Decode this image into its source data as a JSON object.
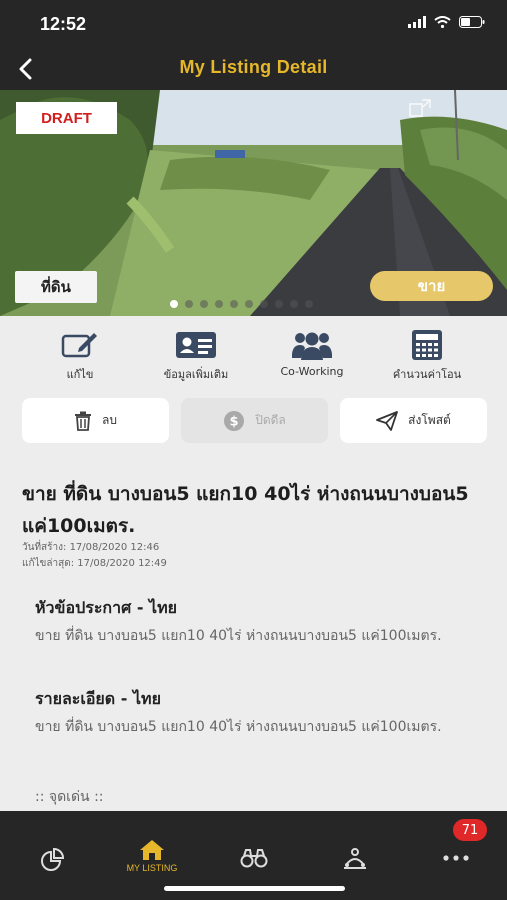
{
  "status_bar": {
    "time": "12:52"
  },
  "nav": {
    "title": "My Listing Detail",
    "back_icon": "chevron-left-icon"
  },
  "hero": {
    "status_badge": "DRAFT",
    "property_type": "ที่ดิน",
    "sale_type": "ขาย",
    "carousel_total": 10,
    "carousel_active": 1
  },
  "actions": [
    {
      "label": "แก้ไข",
      "icon": "edit-icon"
    },
    {
      "label": "ข้อมูลเพิ่มเติม",
      "icon": "id-card-icon"
    },
    {
      "label": "Co-Working",
      "icon": "users-icon"
    },
    {
      "label": "คำนวนค่าโอน",
      "icon": "calculator-icon"
    }
  ],
  "buttons": {
    "delete": "ลบ",
    "close_deal": "ปิดดีล",
    "post": "ส่งโพสต์"
  },
  "listing": {
    "title": "ขาย  ที่ดิน บางบอน5 แยก10 40ไร่  ห่างถนนบางบอน5 แค่100เมตร.",
    "created": "วันที่สร้าง: 17/08/2020 12:46",
    "updated": "แก้ไขล่าสุด: 17/08/2020 12:49"
  },
  "sections": {
    "headline_title": "หัวข้อประกาศ - ไทย",
    "headline_body": "ขาย  ที่ดิน บางบอน5 แยก10 40ไร่  ห่างถนนบางบอน5 แค่100เมตร.",
    "detail_title": "รายละเอียด - ไทย",
    "detail_body": "ขาย  ที่ดิน บางบอน5 แยก10 40ไร่  ห่างถนนบางบอน5 แค่100เมตร.",
    "highlight": ":: จุดเด่น ::"
  },
  "tab_bar": {
    "active_label": "MY LISTING",
    "notification_count": "71"
  },
  "colors": {
    "accent": "#e6b72a",
    "dark": "#262626",
    "draft_red": "#d31e1e",
    "sale_gold": "#e6c769",
    "badge_red": "#e02828"
  }
}
